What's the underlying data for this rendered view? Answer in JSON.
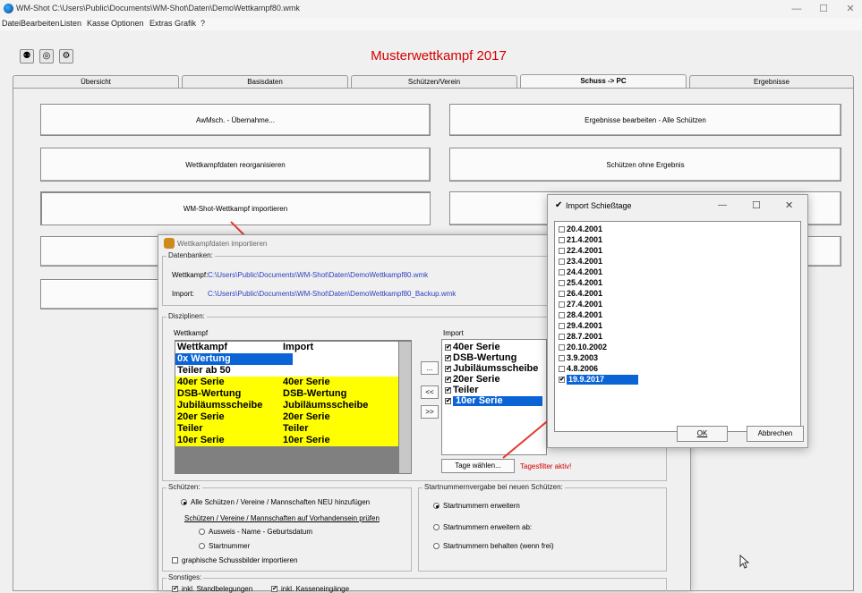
{
  "window": {
    "title": "WM-Shot C:\\Users\\Public\\Documents\\WM-Shot\\Daten\\DemoWettkampf80.wmk",
    "minimize": "—",
    "maximize": "☐",
    "close": "✕"
  },
  "menu": [
    "Datei",
    "Bearbeiten",
    "Listen",
    "Kasse",
    "Optionen",
    "Extras",
    "Grafik",
    "?"
  ],
  "toolbar_icons": [
    "people-icon",
    "target-icon",
    "gears-icon"
  ],
  "app_title": "Musterwettkampf 2017",
  "tabs": [
    "Übersicht",
    "Basisdaten",
    "Schützen/Verein",
    "Schuss -> PC",
    "Ergebnisse"
  ],
  "buttons": {
    "awmsch": "AwMsch. - Übernahme...",
    "ergebnisse_bearbeiten": "Ergebnisse bearbeiten - Alle Schützen",
    "reorganisieren": "Wettkampfdaten reorganisieren",
    "ohne_ergebnis": "Schützen ohne Ergebnis",
    "importieren": "WM-Shot-Wettkampf importieren"
  },
  "import_dialog": {
    "title": "Wettkampfdaten importieren",
    "datenbanken_label": "Datenbanken:",
    "wettkampf_label": "Wettkampf:",
    "wettkampf_path": "C:\\Users\\Public\\Documents\\WM-Shot\\Daten\\DemoWettkampf80.wmk",
    "import_label": "Import:",
    "import_path": "C:\\Users\\Public\\Documents\\WM-Shot\\Daten\\DemoWettkampf80_Backup.wmk",
    "disziplinen_label": "Disziplinen:",
    "wettkampf_col_label": "Wettkampf",
    "import_col_label": "Import",
    "table_headers": [
      "Wettkampf",
      "Import"
    ],
    "table_rows": [
      {
        "w": "0x Wertung",
        "i": ""
      },
      {
        "w": "Teiler ab 50",
        "i": ""
      },
      {
        "w": "40er Serie",
        "i": "40er Serie"
      },
      {
        "w": "DSB-Wertung",
        "i": "DSB-Wertung"
      },
      {
        "w": "Jubiläumsscheibe",
        "i": "Jubiläumsscheibe"
      },
      {
        "w": "20er Serie",
        "i": "20er Serie"
      },
      {
        "w": "Teiler",
        "i": "Teiler"
      },
      {
        "w": "10er Serie",
        "i": "10er Serie"
      }
    ],
    "side_buttons": [
      "...",
      "<<",
      ">>"
    ],
    "import_list": [
      "40er Serie",
      "DSB-Wertung",
      "Jubiläumsscheibe",
      "20er Serie",
      "Teiler",
      "10er Serie"
    ],
    "check_mark": "✔",
    "tage_button": "Tage wählen...",
    "tagesfilter": "Tagesfilter aktiv!",
    "schuetzen_label": "Schützen:",
    "schuetzen_opt1": "Alle Schützen / Vereine / Mannschaften NEU hinzufügen",
    "schuetzen_opt2": "Schützen / Vereine / Mannschaften auf Vorhandensein prüfen",
    "schuetzen_sub1": "Ausweis - Name - Geburtsdatum",
    "schuetzen_sub2": "Startnummer",
    "schussbilder": "graphische Schussbilder importieren",
    "startnr_label": "Startnummernvergabe bei neuen Schützen:",
    "startnr_opt1": "Startnummern erweitern",
    "startnr_opt2": "Startnummern erweitern ab:",
    "startnr_opt3": "Startnummern behalten (wenn frei)",
    "sonstiges_label": "Sonstiges:",
    "sonstiges_opt1": "inkl. Standbelegungen",
    "sonstiges_opt2": "inkl. Kasseneingänge"
  },
  "schiesstage_dialog": {
    "title": "Import Schießtage",
    "title_check": "✔",
    "dates": [
      "20.4.2001",
      "21.4.2001",
      "22.4.2001",
      "23.4.2001",
      "24.4.2001",
      "25.4.2001",
      "26.4.2001",
      "27.4.2001",
      "28.4.2001",
      "29.4.2001",
      "28.7.2001",
      "20.10.2002",
      "3.9.2003",
      "4.8.2006",
      "19.9.2017"
    ],
    "checked": "19.9.2017",
    "ok": "OK",
    "cancel": "Abbrechen",
    "minimize": "—",
    "maximize": "☐",
    "close": "✕"
  },
  "colors": {
    "accent_red": "#d40000",
    "selection_blue": "#0a64d6",
    "yellow_row": "#ffff00",
    "path_blue": "#2a3fbf"
  }
}
